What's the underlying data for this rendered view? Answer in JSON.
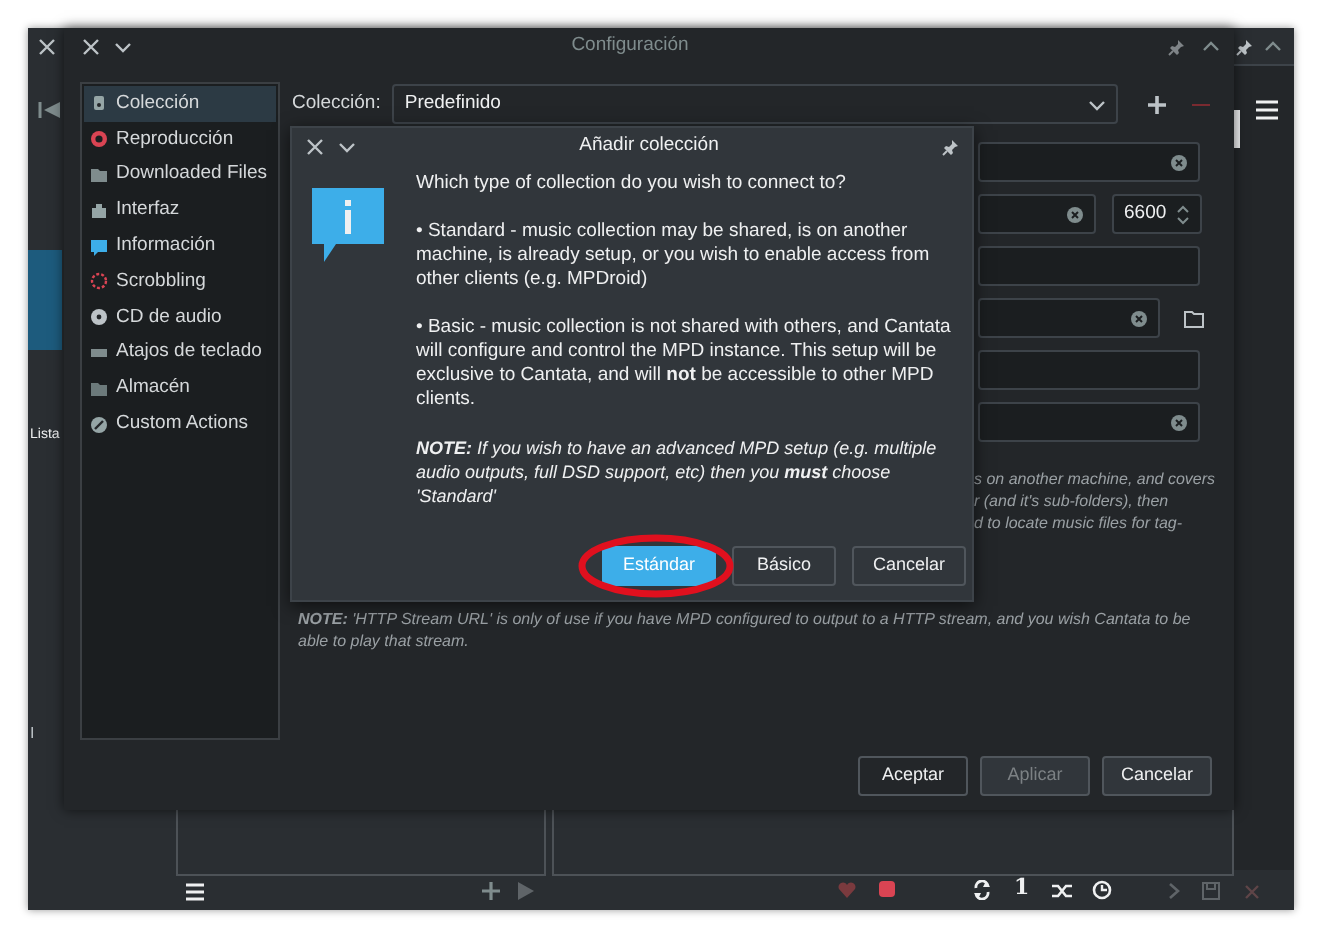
{
  "main_window": {
    "side_labels": [
      "Lista",
      "I"
    ],
    "toolbar_text": "1"
  },
  "config_dialog": {
    "title": "Configuración",
    "sidebar": {
      "items": [
        {
          "label": "Colección",
          "selected": true
        },
        {
          "label": "Reproducción",
          "selected": false
        },
        {
          "label": "Downloaded Files",
          "selected": false
        },
        {
          "label": "Interfaz",
          "selected": false
        },
        {
          "label": "Información",
          "selected": false
        },
        {
          "label": "Scrobbling",
          "selected": false
        },
        {
          "label": "CD de audio",
          "selected": false
        },
        {
          "label": "Atajos de teclado",
          "selected": false
        },
        {
          "label": "Almacén",
          "selected": false
        },
        {
          "label": "Custom Actions",
          "selected": false
        }
      ]
    },
    "collection_label": "Colección:",
    "collection_value": "Predefinido",
    "port": "6600",
    "help_lines": [
      "s on another machine, and covers",
      "r (and it's sub-folders), then",
      "d to locate music files for tag-"
    ],
    "note": "**NOTE:** 'HTTP Stream URL' is only of use if you have MPD configured to output to a HTTP stream, and you wish Cantata to be able to play that stream.",
    "buttons": [
      {
        "label": "Aceptar",
        "disabled": false
      },
      {
        "label": "Aplicar",
        "disabled": true
      },
      {
        "label": "Cancelar",
        "disabled": false
      }
    ]
  },
  "add_collection_dialog": {
    "title": "Añadir colección",
    "paragraphs": [
      "Which type of collection do you wish to connect to?",
      "• Standard - music collection may be shared, is on another machine, is already setup, or you wish to enable access from other clients (e.g. MPDroid)",
      "• Basic - music collection is not shared with others, and Cantata will configure and control the MPD instance. This setup will be exclusive to Cantata, and will **not** be accessible to other MPD clients."
    ],
    "note": "**NOTE:** If you wish to have an advanced MPD setup (e.g. multiple audio outputs, full DSD support, etc) then you **must** choose 'Standard'",
    "buttons": [
      {
        "label": "Estándar",
        "default": true
      },
      {
        "label": "Básico",
        "default": false
      },
      {
        "label": "Cancelar",
        "default": false
      }
    ]
  }
}
